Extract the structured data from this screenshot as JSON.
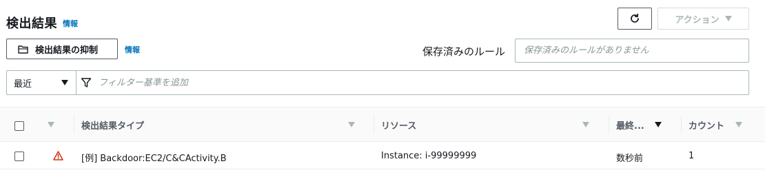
{
  "header": {
    "title": "検出結果",
    "info_label": "情報"
  },
  "toolbar": {
    "refresh_icon": "refresh-icon",
    "action_label": "アクション",
    "suppress_label": "検出結果の抑制",
    "suppress_info_label": "情報",
    "saved_rules_label": "保存済みのルール",
    "saved_rules_placeholder": "保存済みのルールがありません"
  },
  "filter": {
    "select_value": "最近",
    "placeholder": "フィルター基準を追加"
  },
  "table": {
    "columns": [
      {
        "label": "検出結果タイプ"
      },
      {
        "label": "リソース"
      },
      {
        "label": "最終..."
      },
      {
        "label": "カウント"
      }
    ],
    "rows": [
      {
        "severity_icon": "warning-triangle-icon",
        "finding_type": "[例] Backdoor:EC2/C&CActivity.B",
        "resource": "Instance: i-99999999",
        "last_seen": "数秒前",
        "count": "1"
      }
    ]
  },
  "colors": {
    "link": "#0073bb",
    "severity_high": "#d13212",
    "border": "#aab7b8"
  }
}
